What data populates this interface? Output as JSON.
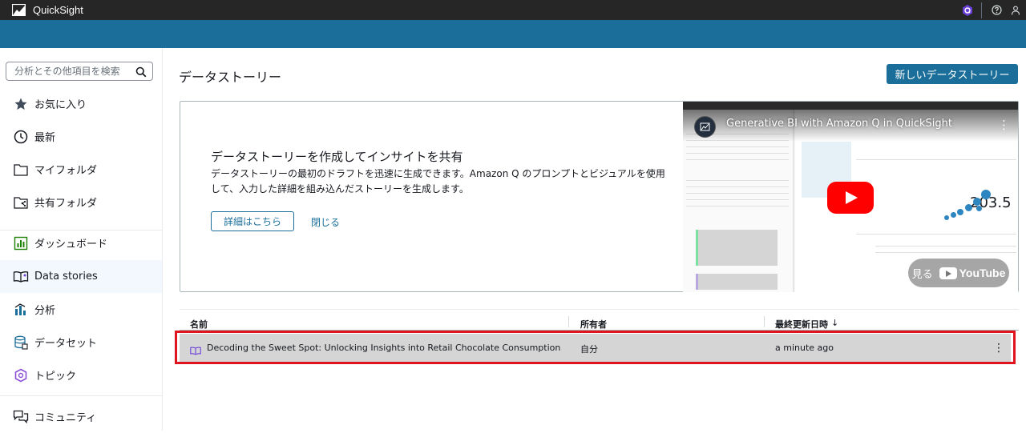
{
  "app": {
    "name": "QuickSight"
  },
  "colors": {
    "topbar": "#262626",
    "band": "#1a6e99",
    "primary": "#1a6e99",
    "highlight": "#e0141e"
  },
  "search": {
    "placeholder": "分析とその他項目を検索"
  },
  "sidebar": {
    "items": [
      {
        "label": "お気に入り",
        "icon": "star-icon"
      },
      {
        "label": "最新",
        "icon": "clock-icon"
      },
      {
        "label": "マイフォルダ",
        "icon": "folder-icon"
      },
      {
        "label": "共有フォルダ",
        "icon": "shared-folder-icon"
      },
      {
        "label": "ダッシュボード",
        "icon": "dashboard-icon"
      },
      {
        "label": "Data stories",
        "icon": "book-icon",
        "active": true
      },
      {
        "label": "分析",
        "icon": "analysis-icon"
      },
      {
        "label": "データセット",
        "icon": "dataset-icon"
      },
      {
        "label": "トピック",
        "icon": "topic-icon"
      },
      {
        "label": "コミュニティ",
        "icon": "community-icon"
      }
    ]
  },
  "main": {
    "title": "データストーリー",
    "new_button": "新しいデータストーリー"
  },
  "promo": {
    "title": "データストーリーを作成してインサイトを共有",
    "description": "データストーリーの最初のドラフトを迅速に生成できます。Amazon Q のプロンプトとビジュアルを使用して、入力した詳細を組み込んだストーリーを生成します。",
    "details_button": "詳細はこちら",
    "close_link": "閉じる",
    "video": {
      "title": "Generative BI with Amazon Q in QuickSight",
      "watch_label": "見る",
      "youtube_label": "YouTube",
      "big_number": "203.5"
    }
  },
  "table": {
    "columns": [
      "名前",
      "所有者",
      "最終更新日時"
    ],
    "sort_indicator": "↓",
    "rows": [
      {
        "name": "Decoding the Sweet Spot: Unlocking Insights into Retail Chocolate Consumption",
        "owner": "自分",
        "updated": "a minute ago"
      }
    ]
  }
}
